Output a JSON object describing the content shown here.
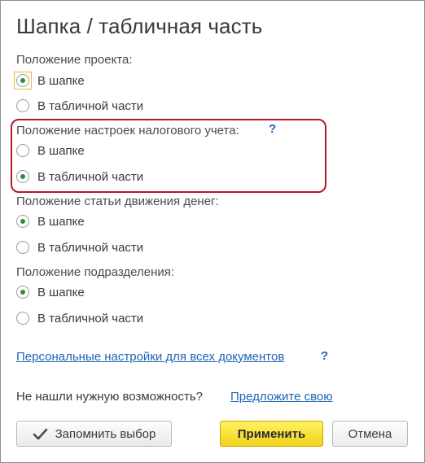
{
  "window": {
    "title": "Шапка / табличная часть"
  },
  "groups": [
    {
      "label": "Положение проекта:",
      "options": [
        {
          "label": "В шапке",
          "checked": true
        },
        {
          "label": "В табличной части",
          "checked": false
        }
      ]
    },
    {
      "label": "Положение настроек налогового учета:",
      "help": "?",
      "highlighted": true,
      "options": [
        {
          "label": "В шапке",
          "checked": false
        },
        {
          "label": "В табличной части",
          "checked": true
        }
      ]
    },
    {
      "label": "Положение статьи движения денег:",
      "options": [
        {
          "label": "В шапке",
          "checked": true
        },
        {
          "label": "В табличной части",
          "checked": false
        }
      ]
    },
    {
      "label": "Положение подразделения:",
      "options": [
        {
          "label": "В шапке",
          "checked": true
        },
        {
          "label": "В табличной части",
          "checked": false
        }
      ]
    }
  ],
  "personal_settings": {
    "link": "Персональные настройки для всех документов",
    "help": "?"
  },
  "feedback": {
    "text": "Не нашли нужную возможность?",
    "link": "Предложите свою"
  },
  "buttons": {
    "remember": "Запомнить выбор",
    "apply": "Применить",
    "cancel": "Отмена"
  },
  "colors": {
    "accent_link": "#1e65b5",
    "radio_dot": "#2c8e3b",
    "highlight_border": "#b3192c",
    "apply_button": "#f7dc2a",
    "focus_frame": "#f0b834"
  },
  "icons": {
    "remember_button": "checkmark-icon"
  }
}
